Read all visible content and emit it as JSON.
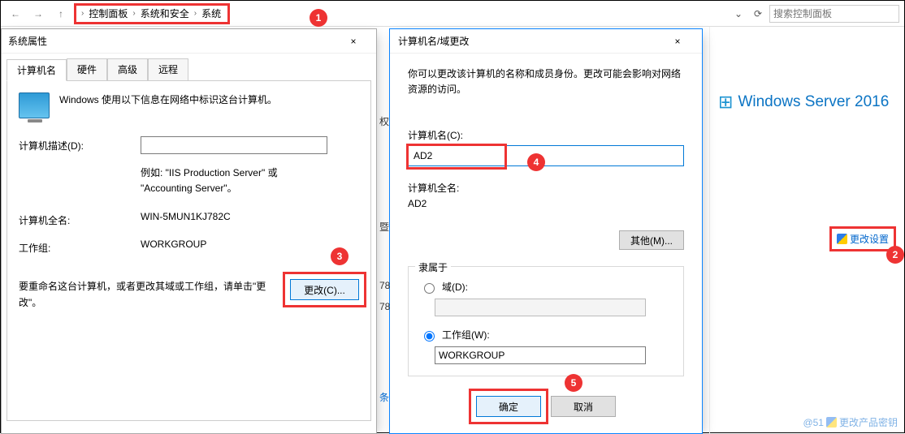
{
  "nav": {
    "back": "←",
    "forward": "→",
    "up": "↑",
    "breadcrumb": [
      "控制面板",
      "系统和安全",
      "系统"
    ],
    "dropdown": "⌄",
    "refresh": "⟳",
    "search_placeholder": "搜索控制面板"
  },
  "right_panel": {
    "logo_text": "Windows Server 2016",
    "change_settings": "更改设置",
    "prod_key": "更改产品密钥",
    "watermark": "@51"
  },
  "sys_props": {
    "title": "系统属性",
    "close": "×",
    "tabs": {
      "t0": "计算机名",
      "t1": "硬件",
      "t2": "高级",
      "t3": "远程"
    },
    "desc": "Windows 使用以下信息在网络中标识这台计算机。",
    "desc_label": "计算机描述(D):",
    "desc_value": "",
    "example": "例如: \"IIS Production Server\" 或 \"Accounting Server\"。",
    "fullname_label": "计算机全名:",
    "fullname_value": "WIN-5MUN1KJ782C",
    "workgroup_label": "工作组:",
    "workgroup_value": "WORKGROUP",
    "rename_text": "要重命名这台计算机，或者更改其域或工作组，请单击\"更改\"。",
    "change_btn": "更改(C)..."
  },
  "name_change": {
    "title": "计算机名/域更改",
    "close": "×",
    "desc": "你可以更改该计算机的名称和成员身份。更改可能会影响对网络资源的访问。",
    "cname_label": "计算机名(C):",
    "cname_value": "AD2",
    "fullname_label": "计算机全名:",
    "fullname_value": "AD2",
    "other_btn": "其他(M)...",
    "member_legend": "隶属于",
    "domain_label": "域(D):",
    "domain_value": "",
    "workgroup_label": "工作组(W):",
    "workgroup_value": "WORKGROUP",
    "ok": "确定",
    "cancel": "取消"
  },
  "peek": {
    "p1": "权",
    "p2": "暨",
    "p3": "78",
    "p4": "78",
    "p5": "条"
  },
  "badges": {
    "b1": "1",
    "b2": "2",
    "b3": "3",
    "b4": "4",
    "b5": "5"
  }
}
